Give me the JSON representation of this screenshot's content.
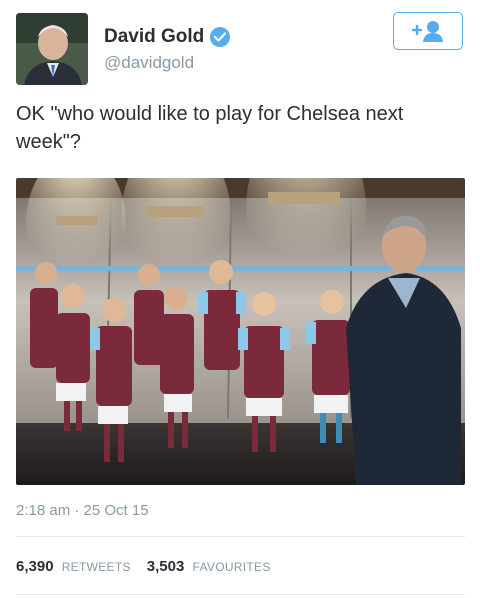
{
  "user": {
    "name": "David Gold",
    "handle": "@davidgold"
  },
  "tweet": {
    "text": "OK \"who would like to play for Chelsea next week\"?",
    "timestamp": "2:18 am · 25 Oct 15"
  },
  "stats": {
    "retweets_count": "6,390",
    "retweets_label": "RETWEETS",
    "favourites_count": "3,503",
    "favourites_label": "FAVOURITES"
  },
  "colors": {
    "accent": "#55acee",
    "text": "#292f33",
    "muted": "#8899a6"
  },
  "icons": [
    "verified-badge-icon",
    "follow-user-icon"
  ]
}
